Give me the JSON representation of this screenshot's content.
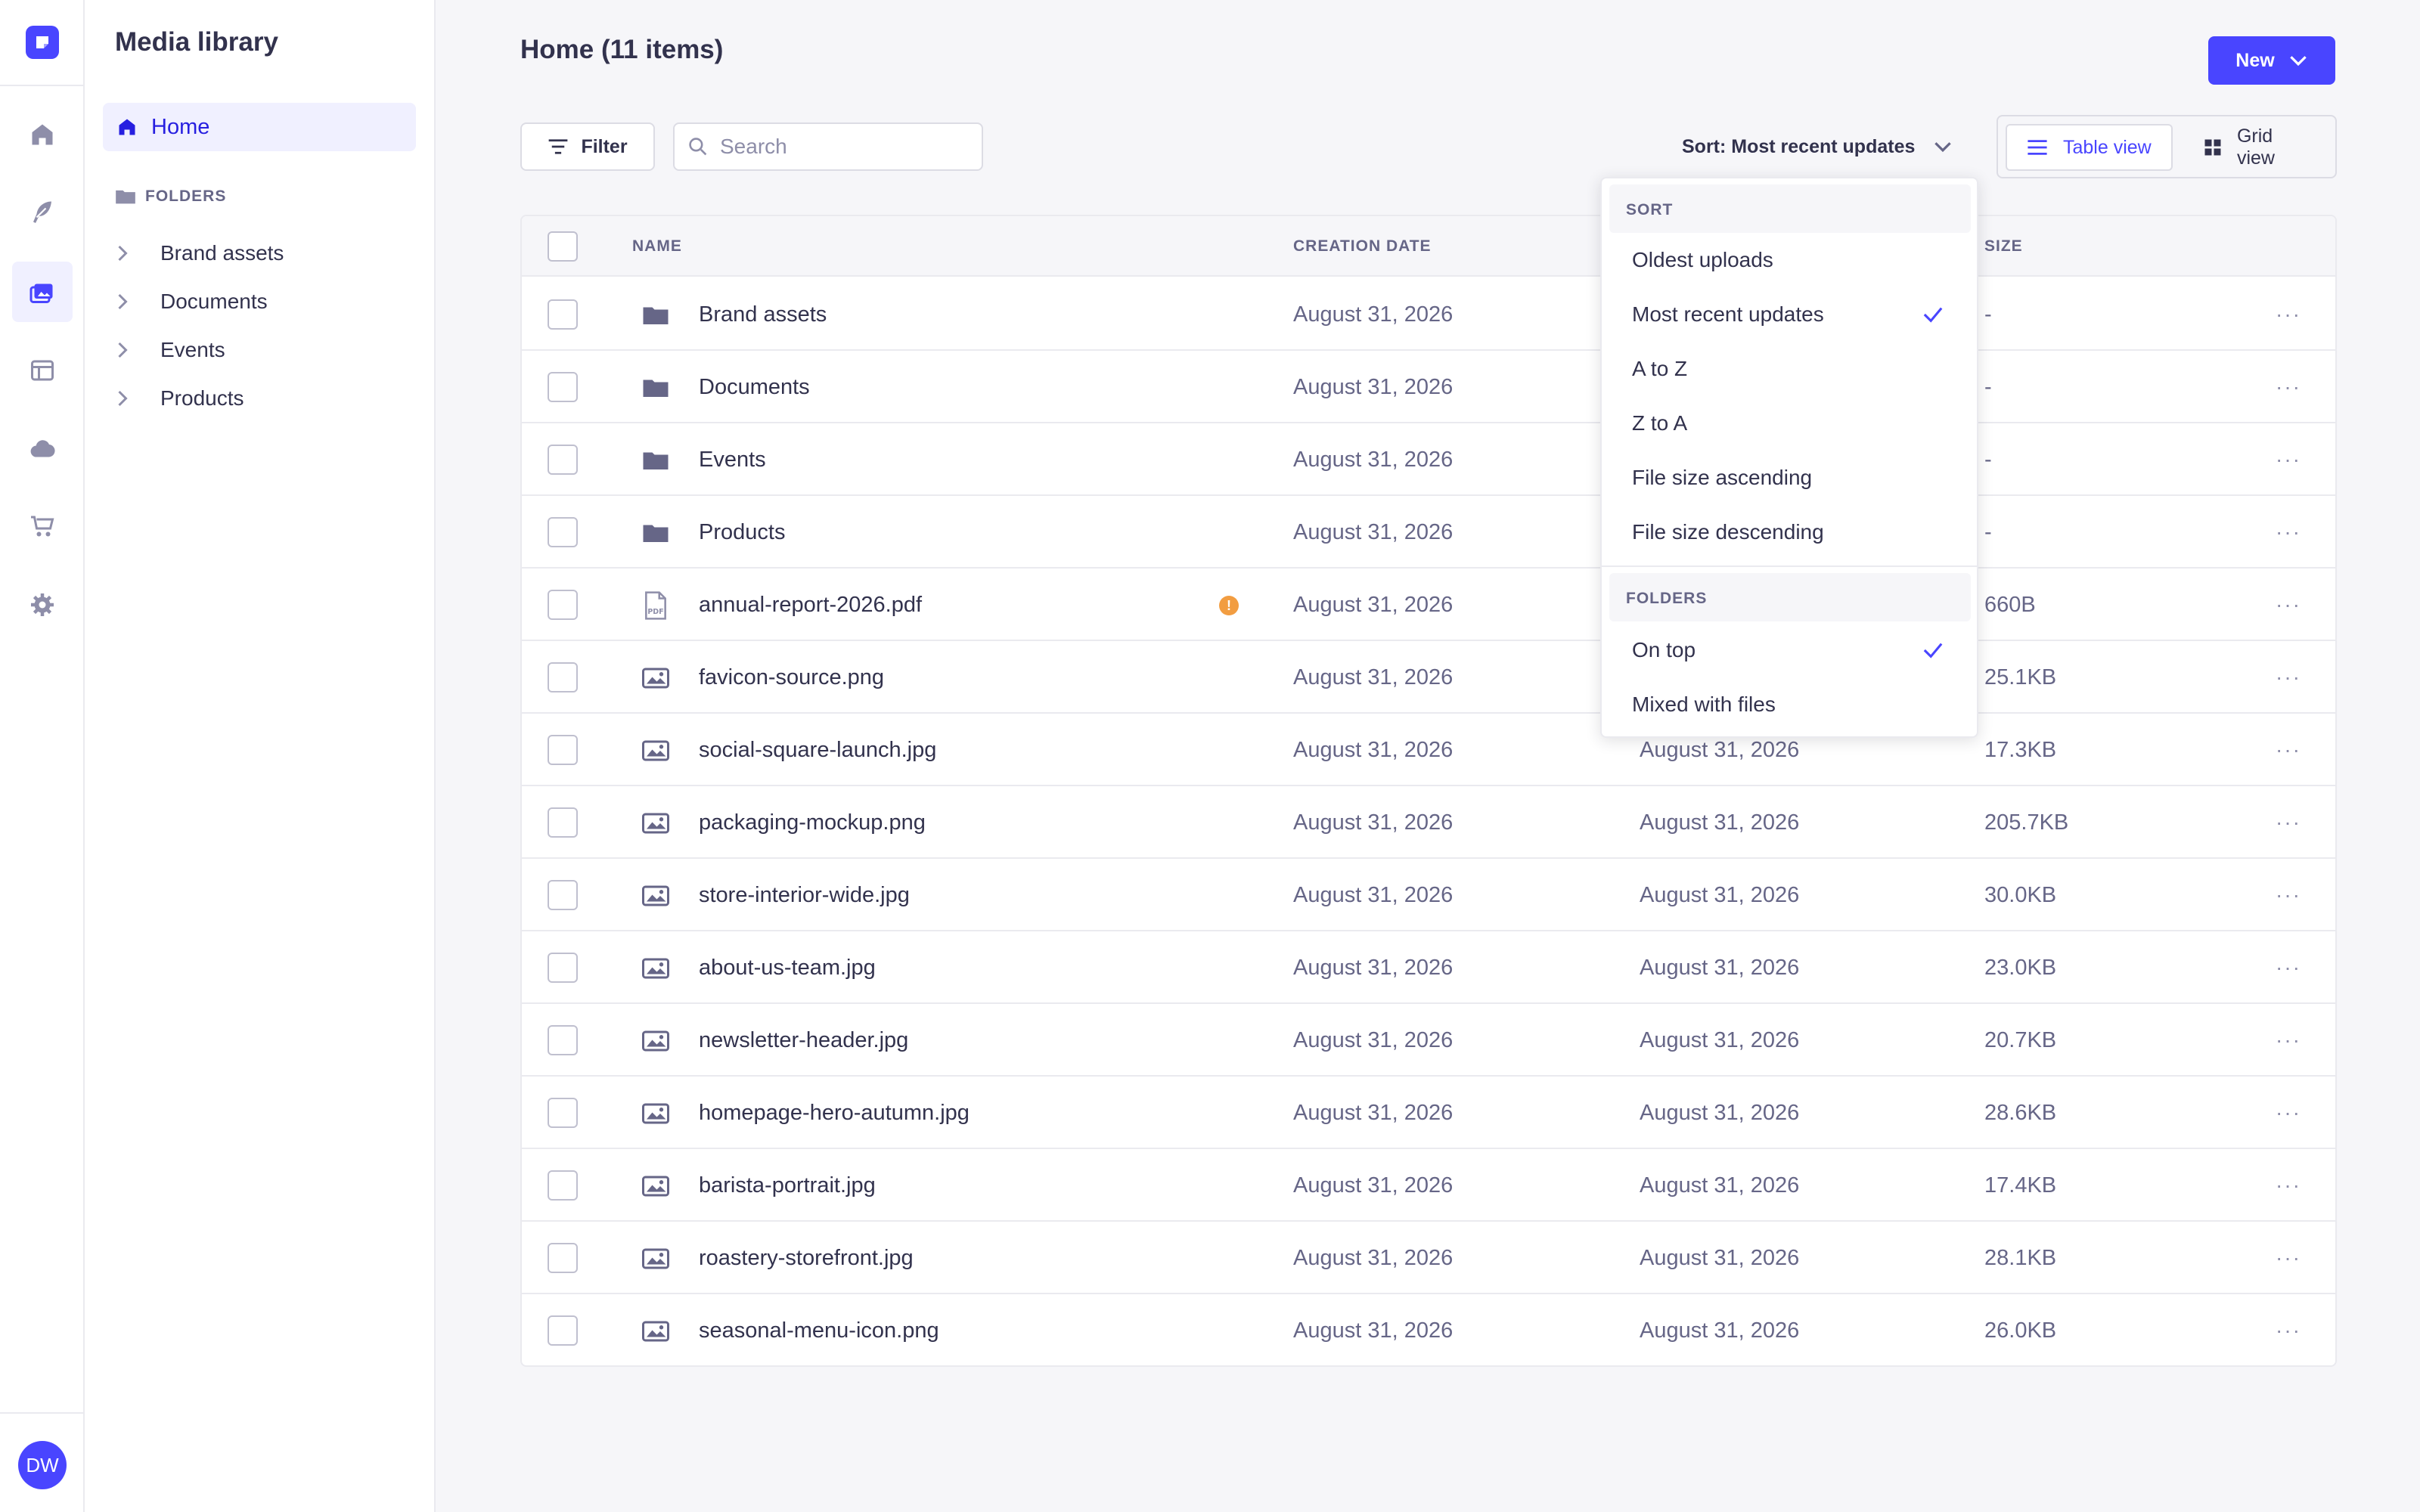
{
  "rail": {
    "avatar_initials": "DW",
    "icons": [
      "home-icon",
      "feather-icon",
      "media-library-icon",
      "layout-icon",
      "cloud-icon",
      "cart-icon",
      "gear-icon"
    ]
  },
  "subnav": {
    "title": "Media library",
    "home_label": "Home",
    "folders_heading": "FOLDERS",
    "folders": [
      "Brand assets",
      "Documents",
      "Events",
      "Products"
    ]
  },
  "header": {
    "title": "Home (11 items)",
    "new_label": "New"
  },
  "toolbar": {
    "filter_label": "Filter",
    "search_placeholder": "Search",
    "sort_label": "Sort: Most recent updates",
    "table_view_label": "Table view",
    "grid_view_label": "Grid view"
  },
  "table": {
    "columns": {
      "name": "NAME",
      "creation_date": "CREATION DATE",
      "size": "SIZE"
    },
    "rows": [
      {
        "type": "folder",
        "name": "Brand assets",
        "created": "August 31, 2026",
        "updated": "",
        "size": "-"
      },
      {
        "type": "folder",
        "name": "Documents",
        "created": "August 31, 2026",
        "updated": "",
        "size": "-"
      },
      {
        "type": "folder",
        "name": "Events",
        "created": "August 31, 2026",
        "updated": "",
        "size": "-"
      },
      {
        "type": "folder",
        "name": "Products",
        "created": "August 31, 2026",
        "updated": "",
        "size": "-"
      },
      {
        "type": "pdf",
        "name": "annual-report-2026.pdf",
        "warning": "!",
        "created": "August 31, 2026",
        "updated": "",
        "size": "660B"
      },
      {
        "type": "image",
        "name": "favicon-source.png",
        "created": "August 31, 2026",
        "updated": "",
        "size": "25.1KB"
      },
      {
        "type": "image",
        "name": "social-square-launch.jpg",
        "created": "August 31, 2026",
        "updated": "August 31, 2026",
        "size": "17.3KB"
      },
      {
        "type": "image",
        "name": "packaging-mockup.png",
        "created": "August 31, 2026",
        "updated": "August 31, 2026",
        "size": "205.7KB"
      },
      {
        "type": "image",
        "name": "store-interior-wide.jpg",
        "created": "August 31, 2026",
        "updated": "August 31, 2026",
        "size": "30.0KB"
      },
      {
        "type": "image",
        "name": "about-us-team.jpg",
        "created": "August 31, 2026",
        "updated": "August 31, 2026",
        "size": "23.0KB"
      },
      {
        "type": "image",
        "name": "newsletter-header.jpg",
        "created": "August 31, 2026",
        "updated": "August 31, 2026",
        "size": "20.7KB"
      },
      {
        "type": "image",
        "name": "homepage-hero-autumn.jpg",
        "created": "August 31, 2026",
        "updated": "August 31, 2026",
        "size": "28.6KB"
      },
      {
        "type": "image",
        "name": "barista-portrait.jpg",
        "created": "August 31, 2026",
        "updated": "August 31, 2026",
        "size": "17.4KB"
      },
      {
        "type": "image",
        "name": "roastery-storefront.jpg",
        "created": "August 31, 2026",
        "updated": "August 31, 2026",
        "size": "28.1KB"
      },
      {
        "type": "image",
        "name": "seasonal-menu-icon.png",
        "created": "August 31, 2026",
        "updated": "August 31, 2026",
        "size": "26.0KB"
      }
    ]
  },
  "sort_menu": {
    "sort_heading": "SORT",
    "sort_options": [
      {
        "label": "Oldest uploads",
        "selected": false
      },
      {
        "label": "Most recent updates",
        "selected": true
      },
      {
        "label": "A to Z",
        "selected": false
      },
      {
        "label": "Z to A",
        "selected": false
      },
      {
        "label": "File size ascending",
        "selected": false
      },
      {
        "label": "File size descending",
        "selected": false
      }
    ],
    "folders_heading": "FOLDERS",
    "folder_options": [
      {
        "label": "On top",
        "selected": true
      },
      {
        "label": "Mixed with files",
        "selected": false
      }
    ]
  },
  "colors": {
    "primary": "#4945ff",
    "primary_light": "#f0f0ff",
    "text": "#32324d",
    "muted": "#666687",
    "warning": "#f29d41"
  }
}
